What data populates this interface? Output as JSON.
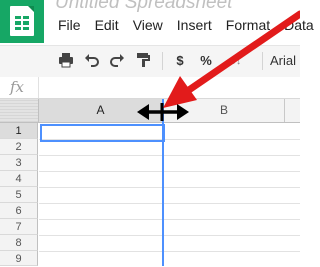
{
  "app": {
    "title": "Untitled Spreadsheet",
    "brand_color": "#16a765"
  },
  "menu": {
    "items": [
      "File",
      "Edit",
      "View",
      "Insert",
      "Format",
      "Data"
    ]
  },
  "toolbar": {
    "print_icon": "print-icon",
    "undo_icon": "undo-icon",
    "redo_icon": "redo-icon",
    "paint_format_icon": "paint-format-icon",
    "currency_label": "$",
    "percent_label": "%",
    "more_formats_label": ".0↓",
    "font_label": "Arial"
  },
  "formula_bar": {
    "label": "fx",
    "value": ""
  },
  "grid": {
    "columns": [
      "A",
      "B"
    ],
    "rows": [
      "1",
      "2",
      "3",
      "4",
      "5",
      "6",
      "7",
      "8",
      "9"
    ],
    "selected_column": "A",
    "selected_row": "1",
    "selection_color": "#4d90fe"
  },
  "annotation": {
    "arrow_color": "#e21b1b",
    "resize_cursor": "column-resize-cursor"
  }
}
